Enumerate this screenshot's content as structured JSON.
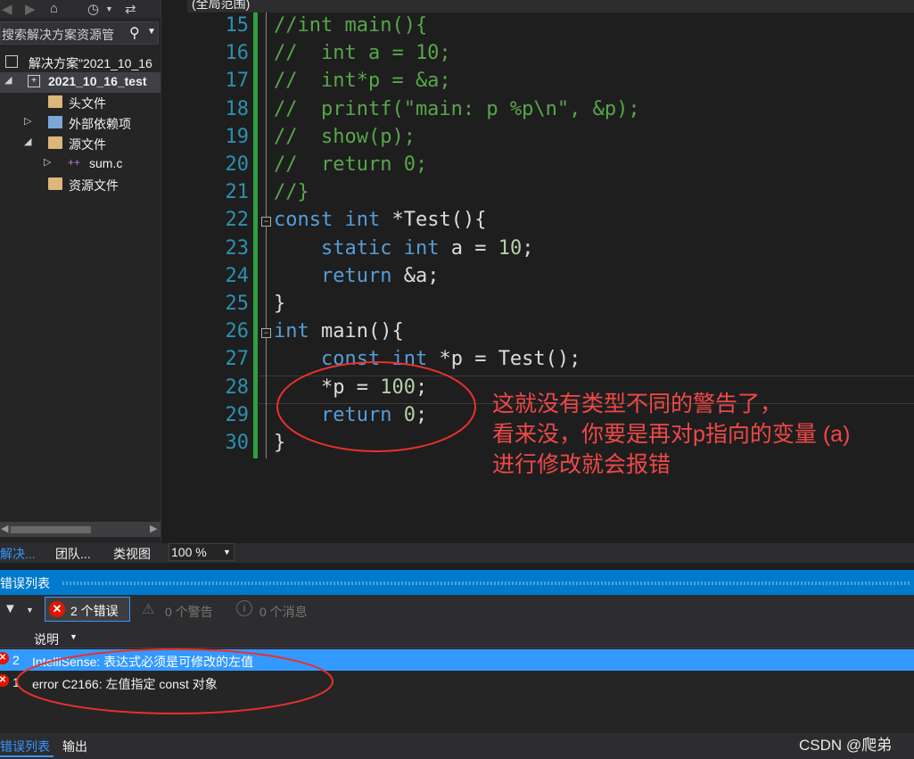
{
  "solution_explorer": {
    "search_placeholder": "搜索解决方案资源管",
    "solution_label": "解决方案\"2021_10_16",
    "project_label": "2021_10_16_test",
    "items": [
      {
        "label": "头文件",
        "icon": "folder-icon"
      },
      {
        "label": "外部依赖项",
        "icon": "dependencies-icon"
      },
      {
        "label": "源文件",
        "icon": "folder-icon"
      },
      {
        "label": "sum.c",
        "icon": "c-file-icon"
      },
      {
        "label": "资源文件",
        "icon": "folder-icon"
      }
    ]
  },
  "editor": {
    "scope_label": "(全局范围)",
    "zoom": "100 %",
    "current_line": 28,
    "lines": [
      {
        "num": "15",
        "text": "//int main(){"
      },
      {
        "num": "16",
        "text": "//  int a = 10;"
      },
      {
        "num": "17",
        "text": "//  int*p = &a;"
      },
      {
        "num": "18",
        "text": "//  printf(\"main: p %p\\n\", &p);"
      },
      {
        "num": "19",
        "text": "//  show(p);"
      },
      {
        "num": "20",
        "text": "//  return 0;"
      },
      {
        "num": "21",
        "text": "//}"
      },
      {
        "num": "22",
        "text": "const int *Test(){"
      },
      {
        "num": "23",
        "text": "    static int a = 10;"
      },
      {
        "num": "24",
        "text": "    return &a;"
      },
      {
        "num": "25",
        "text": "}"
      },
      {
        "num": "26",
        "text": "int main(){"
      },
      {
        "num": "27",
        "text": "    const int *p = Test();"
      },
      {
        "num": "28",
        "text": "    *p = 100;"
      },
      {
        "num": "29",
        "text": "    return 0;"
      },
      {
        "num": "30",
        "text": "}"
      }
    ]
  },
  "annotation": {
    "line1": "这就没有类型不同的警告了，",
    "line2": "看来没，你要是再对p指向的变量 (a)",
    "line3": "进行修改就会报错",
    "color": "#f04848"
  },
  "panel_tabs": [
    "解决...",
    "团队...",
    "类视图"
  ],
  "error_list": {
    "title": "错误列表",
    "errors_filter": "2 个错误",
    "warnings_filter": "0 个警告",
    "messages_filter": "0 个消息",
    "column_description": "说明",
    "rows": [
      {
        "index": "2",
        "text": "IntelliSense: 表达式必须是可修改的左值",
        "selected": true
      },
      {
        "index": "1",
        "text": "error C2166: 左值指定 const 对象",
        "selected": false
      }
    ]
  },
  "bottom_tabs": [
    "错误列表",
    "输出"
  ],
  "watermark": "CSDN @爬弟",
  "colors": {
    "accent": "#007acc",
    "keyword": "#569cd6",
    "comment": "#57a64a",
    "number": "#b5cea8",
    "line_number": "#2b91af"
  }
}
